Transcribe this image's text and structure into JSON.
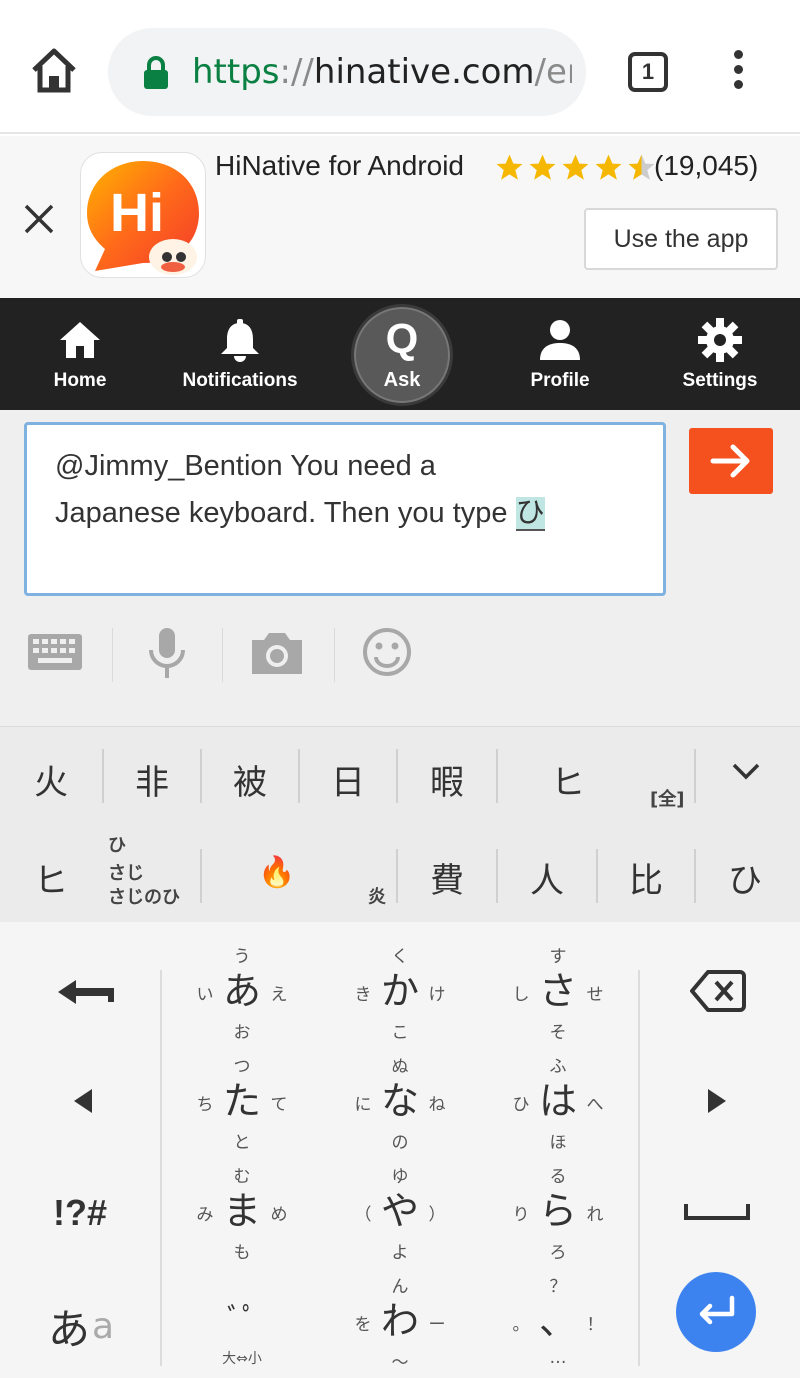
{
  "browser": {
    "url_scheme": "https",
    "url_sep": "://",
    "url_host": "hinative.com",
    "url_path": "/en",
    "tab_count": "1"
  },
  "app_banner": {
    "app_name": "HiNative for Android",
    "rating": 4.5,
    "rating_count": "(19,045)",
    "use_app_label": "Use the app",
    "icon_text": "Hi"
  },
  "nav": {
    "items": [
      {
        "label": "Home",
        "icon": "home-icon"
      },
      {
        "label": "Notifications",
        "icon": "bell-icon"
      },
      {
        "label": "Ask",
        "icon": "Q"
      },
      {
        "label": "Profile",
        "icon": "person-icon"
      },
      {
        "label": "Settings",
        "icon": "gear-icon"
      }
    ]
  },
  "compose": {
    "text_line1": "@Jimmy_Bention You need a",
    "text_line2": "Japanese keyboard. Then you type ",
    "composing_char": "ひ",
    "tools": [
      "keyboard-icon",
      "microphone-icon",
      "camera-icon",
      "emoji-icon"
    ]
  },
  "candidates": {
    "row1": [
      "火",
      "非",
      "被",
      "日",
      "暇",
      "ヒ"
    ],
    "row1_badge": "[全]",
    "row2_first": "ヒ",
    "row2_hint": [
      "ひ",
      "さじ",
      "さじのひ"
    ],
    "row2_emoji": "🔥",
    "row2_emoji_note": "炎",
    "row2_rest": [
      "費",
      "人",
      "比",
      "ひ"
    ]
  },
  "keyboard": {
    "symbols_label": "!?#",
    "mode_main": "あ",
    "mode_sub": "a",
    "keys": [
      {
        "c": "あ",
        "u": "う",
        "d": "お",
        "l": "い",
        "r": "え"
      },
      {
        "c": "か",
        "u": "く",
        "d": "こ",
        "l": "き",
        "r": "け"
      },
      {
        "c": "さ",
        "u": "す",
        "d": "そ",
        "l": "し",
        "r": "せ"
      },
      {
        "c": "た",
        "u": "つ",
        "d": "と",
        "l": "ち",
        "r": "て"
      },
      {
        "c": "な",
        "u": "ぬ",
        "d": "の",
        "l": "に",
        "r": "ね"
      },
      {
        "c": "は",
        "u": "ふ",
        "d": "ほ",
        "l": "ひ",
        "r": "へ"
      },
      {
        "c": "ま",
        "u": "む",
        "d": "も",
        "l": "み",
        "r": "め"
      },
      {
        "c": "や",
        "u": "ゆ",
        "d": "よ",
        "l": "（",
        "r": "）"
      },
      {
        "c": "ら",
        "u": "る",
        "d": "ろ",
        "l": "り",
        "r": "れ"
      },
      {
        "c": "ﾞﾟ",
        "u": "",
        "d": "大⇔小",
        "l": "",
        "r": ""
      },
      {
        "c": "わ",
        "u": "ん",
        "d": "〜",
        "l": "を",
        "r": "ー"
      },
      {
        "c": "、",
        "u": "？",
        "d": "…",
        "l": "。",
        "r": "！"
      }
    ]
  },
  "colors": {
    "nav_bg": "#222222",
    "accent_orange": "#f4511e",
    "enter_blue": "#3d83f0",
    "url_green": "#0b8043",
    "star_yellow": "#f6b700"
  }
}
